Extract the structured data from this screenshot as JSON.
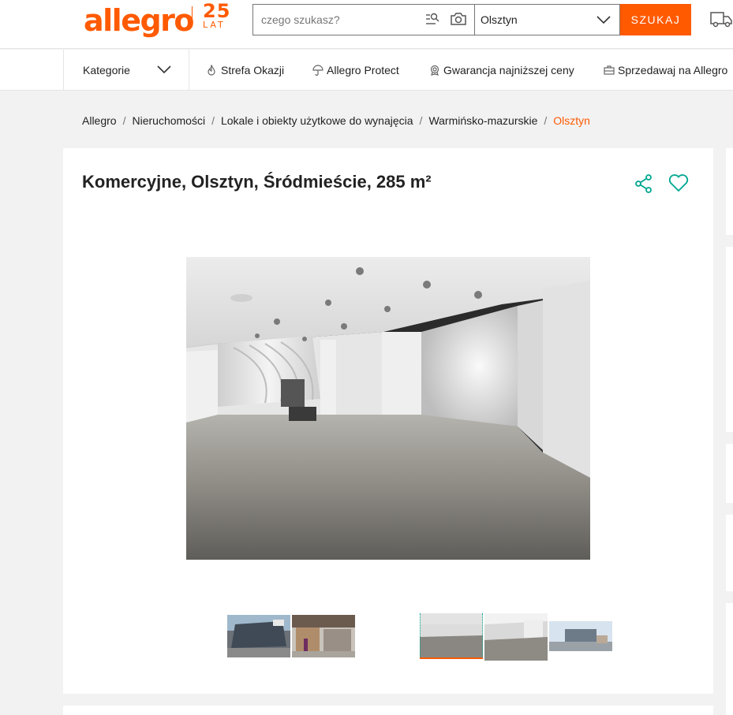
{
  "header": {
    "logo_text": "allegro",
    "badge_number": "25",
    "badge_text": "LAT",
    "search_placeholder": "czego szukasz?",
    "search_category": "Olsztyn",
    "search_button": "SZUKAJ",
    "brand_color": "#ff5a00"
  },
  "nav": {
    "categories_label": "Kategorie",
    "items": [
      {
        "label": "Strefa Okazji",
        "icon": "flame-icon"
      },
      {
        "label": "Allegro Protect",
        "icon": "umbrella-icon"
      },
      {
        "label": "Gwarancja najniższej ceny",
        "icon": "badge-icon"
      },
      {
        "label": "Sprzedawaj na Allegro",
        "icon": "briefcase-icon"
      }
    ]
  },
  "breadcrumb": [
    "Allegro",
    "Nieruchomości",
    "Lokale i obiekty użytkowe do wynajęcia",
    "Warmińsko-mazurskie",
    "Olsztyn"
  ],
  "listing": {
    "title": "Komercyjne, Olsztyn, Śródmieście, 285 m²",
    "accent_color": "#00a790",
    "gallery": {
      "selected_index": 2,
      "thumbnails": [
        "building-exterior",
        "shop-entrance",
        "empty-hall",
        "interior-room",
        "street-view"
      ]
    }
  }
}
